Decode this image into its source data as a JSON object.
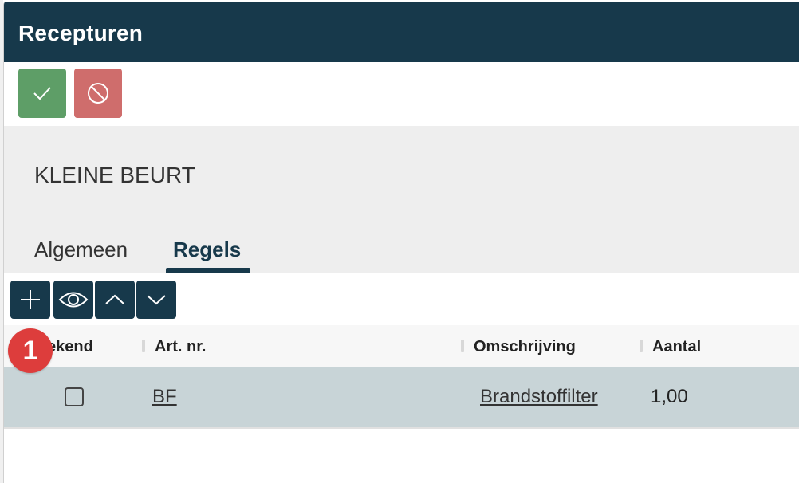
{
  "dialog": {
    "title": "Recepturen"
  },
  "toolbar": {
    "confirm_icon": "check-icon",
    "cancel_icon": "ban-icon",
    "colors": {
      "confirm": "#5e9e67",
      "cancel": "#cf6d6c",
      "titlebar": "#17394b"
    }
  },
  "record": {
    "title": "KLEINE BEURT"
  },
  "tabs": [
    {
      "label": "Algemeen",
      "active": false
    },
    {
      "label": "Regels",
      "active": true
    }
  ],
  "grid_toolbar": {
    "icons": [
      "plus-icon",
      "eye-icon",
      "chevron-up-icon",
      "chevron-down-icon"
    ]
  },
  "table": {
    "columns": [
      "ekend",
      "Art. nr.",
      "Omschrijving",
      "Aantal"
    ],
    "rows": [
      {
        "checked": false,
        "art_nr": "BF",
        "omschrijving": "Brandstoffilter",
        "aantal": "1,00"
      }
    ]
  },
  "badge": {
    "number": "1"
  }
}
